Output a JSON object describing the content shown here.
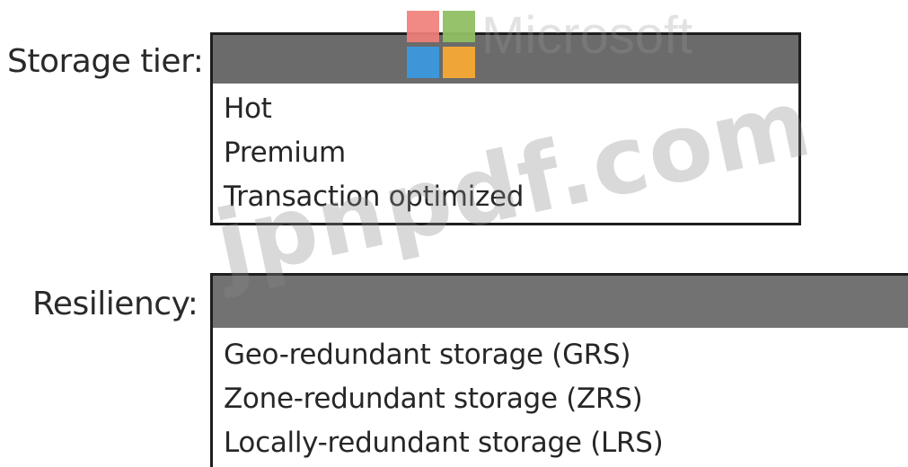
{
  "storage_tier": {
    "label": "Storage tier:",
    "options": [
      "Hot",
      "Premium",
      "Transaction optimized"
    ]
  },
  "resiliency": {
    "label": "Resiliency:",
    "options": [
      "Geo-redundant storage (GRS)",
      "Zone-redundant storage (ZRS)",
      "Locally-redundant storage (LRS)"
    ]
  },
  "watermarks": {
    "logo_text": "Microsoft",
    "site_text": "jpnpdf.com"
  },
  "colors": {
    "dropdown_header": "#6b6b6b",
    "border": "#1e1e1e",
    "logo_red": "#f0807a",
    "logo_green": "#8fbf62",
    "logo_blue": "#3d96d8",
    "logo_yellow": "#f0a636"
  }
}
